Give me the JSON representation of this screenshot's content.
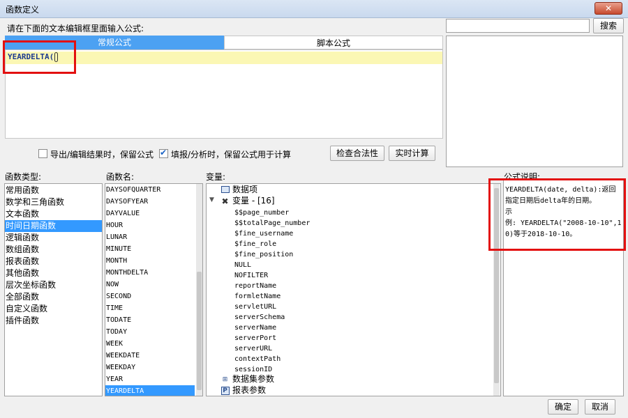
{
  "window": {
    "title": "函数定义",
    "close_label": "✕"
  },
  "prompt_label": "请在下面的文本编辑框里面输入公式:",
  "search": {
    "value": "",
    "button_label": "搜索"
  },
  "tabs": [
    {
      "label": "常规公式",
      "active": true
    },
    {
      "label": "脚本公式",
      "active": false
    }
  ],
  "editor": {
    "code": "YEARDELTA("
  },
  "options": {
    "export_keep_formula": {
      "label": "导出/编辑结果时，保留公式",
      "checked": false
    },
    "fill_keep_formula": {
      "label": "填报/分析时，保留公式用于计算",
      "checked": true
    },
    "check_button": "检查合法性",
    "realtime_button": "实时计算"
  },
  "headers": {
    "function_type": "函数类型:",
    "function_name": "函数名:",
    "variables": "变量:",
    "formula_desc": "公式说明:"
  },
  "function_types": [
    "常用函数",
    "数学和三角函数",
    "文本函数",
    "时间日期函数",
    "逻辑函数",
    "数组函数",
    "报表函数",
    "其他函数",
    "层次坐标函数",
    "全部函数",
    "自定义函数",
    "插件函数"
  ],
  "function_types_selected": "时间日期函数",
  "function_names": [
    "DAYSOFQUARTER",
    "DAYSOFYEAR",
    "DAYVALUE",
    "HOUR",
    "LUNAR",
    "MINUTE",
    "MONTH",
    "MONTHDELTA",
    "NOW",
    "SECOND",
    "TIME",
    "TODATE",
    "TODAY",
    "WEEK",
    "WEEKDATE",
    "WEEKDAY",
    "YEAR",
    "YEARDELTA"
  ],
  "function_names_selected": "YEARDELTA",
  "variables_tree": {
    "data_items": "数据项",
    "vars_group": "变量 - [16]",
    "vars": [
      "$$page_number",
      "$$totalPage_number",
      "$fine_username",
      "$fine_role",
      "$fine_position",
      "NULL",
      "NOFILTER",
      "reportName",
      "formletName",
      "servletURL",
      "serverSchema",
      "serverName",
      "serverPort",
      "serverURL",
      "contextPath",
      "sessionID"
    ],
    "dataset_params": "数据集参数",
    "report_params": "报表参数"
  },
  "description": "YEARDELTA(date, delta):返回指定日期后delta年的日期。\n示\n例: YEARDELTA(\"2008-10-10\",10)等于2018-10-10。",
  "footer": {
    "ok_label": "确定",
    "cancel_label": "取消"
  },
  "colors": {
    "accent": "#3399ff",
    "highlight_box": "#e31010",
    "current_line": "#fbf7b4"
  }
}
